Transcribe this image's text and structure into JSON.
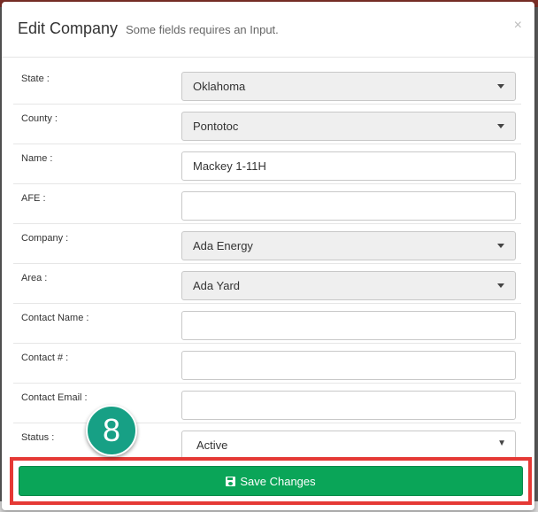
{
  "modal": {
    "title": "Edit Company",
    "subtitle": "Some fields requires an Input.",
    "close_glyph": "×"
  },
  "form": {
    "state": {
      "label": "State :",
      "value": "Oklahoma"
    },
    "county": {
      "label": "County :",
      "value": "Pontotoc"
    },
    "name": {
      "label": "Name :",
      "value": "Mackey 1-11H"
    },
    "afe": {
      "label": "AFE :",
      "value": ""
    },
    "company": {
      "label": "Company :",
      "value": "Ada Energy"
    },
    "area": {
      "label": "Area :",
      "value": "Ada Yard"
    },
    "contact_name": {
      "label": "Contact Name :",
      "value": ""
    },
    "contact_number": {
      "label": "Contact # :",
      "value": ""
    },
    "contact_email": {
      "label": "Contact Email :",
      "value": ""
    },
    "status": {
      "label": "Status :",
      "value": "Active"
    }
  },
  "footer": {
    "save_label": "Save Changes"
  },
  "annotation": {
    "step": "8"
  },
  "colors": {
    "save_button": "#0aa558",
    "highlight_border": "#e53935",
    "step_badge": "#17a085"
  },
  "icons": {
    "save": "floppy-disk-icon",
    "dropdown": "caret-down-icon",
    "close": "close-icon"
  }
}
